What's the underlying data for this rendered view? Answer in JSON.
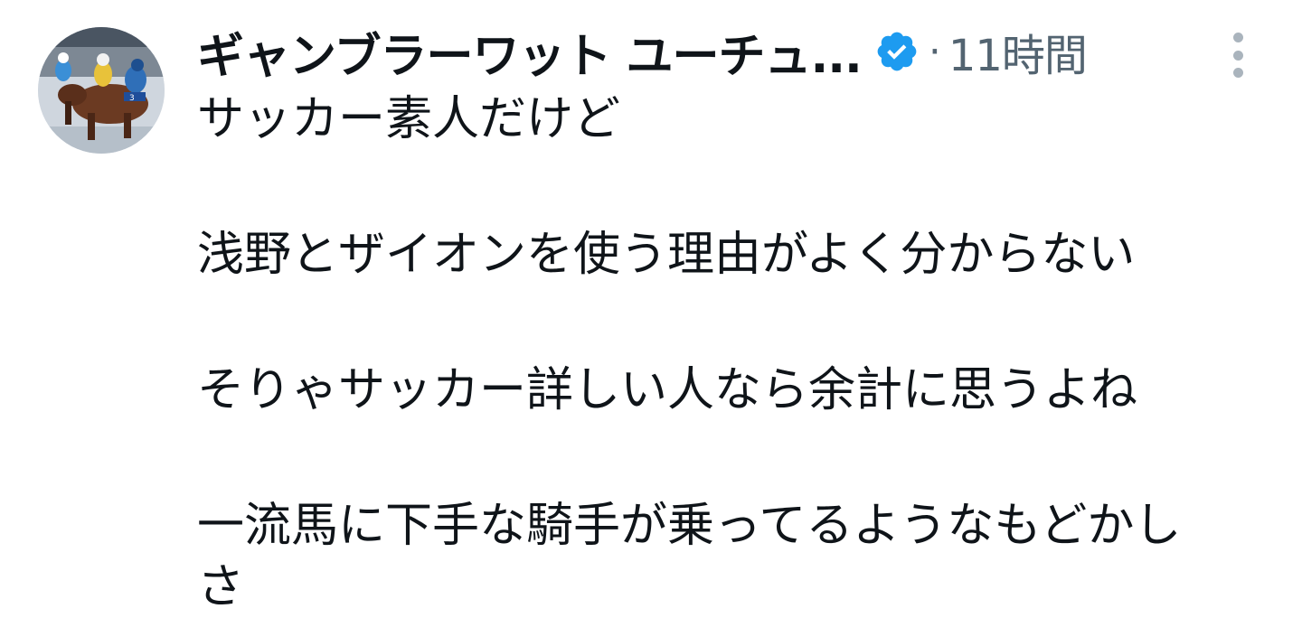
{
  "tweet": {
    "display_name": "ギャンブラーワット ユーチュ...",
    "separator": "·",
    "time": "11時間",
    "verified": true,
    "colors": {
      "verified_badge": "#1d9bf0",
      "secondary_text": "#536471",
      "primary_text": "#0f1419",
      "more_dots": "#aab4bd"
    },
    "icons": {
      "avatar": "horse-racing-avatar",
      "verified": "verified-badge-icon",
      "more": "more-vertical-icon"
    },
    "lines": [
      "サッカー素人だけど",
      "浅野とザイオンを使う理由がよく分からない",
      "そりゃサッカー詳しい人なら余計に思うよね",
      "一流馬に下手な騎手が乗ってるようなもどかし",
      "さ"
    ]
  }
}
